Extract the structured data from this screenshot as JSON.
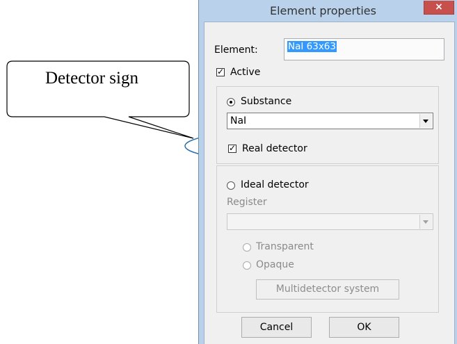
{
  "callout": {
    "text": "Detector sign"
  },
  "dialog": {
    "title": "Element properties",
    "close_icon": "×",
    "element_label": "Element:",
    "element_value": "NaI 63x63",
    "active_label": "Active",
    "active_checked": true,
    "substance": {
      "label": "Substance",
      "selected": true,
      "combo_value": "NaI",
      "real_detector_label": "Real detector",
      "real_detector_checked": true
    },
    "ideal": {
      "label": "Ideal detector",
      "selected": false,
      "register_label": "Register",
      "register_value": "",
      "transparent_label": "Transparent",
      "opaque_label": "Opaque",
      "multidetector_button": "Multidetector system"
    },
    "cancel_button": "Cancel",
    "ok_button": "OK"
  },
  "icons": {
    "close": "close-icon",
    "dropdown": "chevron-down-icon",
    "check": "checkmark-icon"
  },
  "colors": {
    "titlebar": "#b9d1ea",
    "close_button": "#c7504d",
    "selection": "#3399ff",
    "callout_ellipse": "#2e6ea6"
  }
}
